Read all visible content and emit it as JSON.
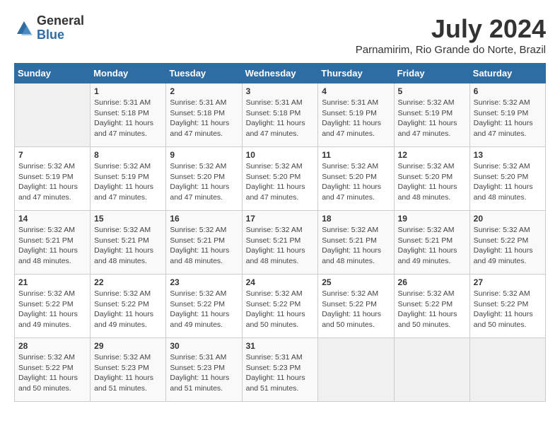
{
  "logo": {
    "general": "General",
    "blue": "Blue"
  },
  "title": {
    "month_year": "July 2024",
    "location": "Parnamirim, Rio Grande do Norte, Brazil"
  },
  "weekdays": [
    "Sunday",
    "Monday",
    "Tuesday",
    "Wednesday",
    "Thursday",
    "Friday",
    "Saturday"
  ],
  "weeks": [
    [
      {
        "day": "",
        "info": ""
      },
      {
        "day": "1",
        "info": "Sunrise: 5:31 AM\nSunset: 5:18 PM\nDaylight: 11 hours\nand 47 minutes."
      },
      {
        "day": "2",
        "info": "Sunrise: 5:31 AM\nSunset: 5:18 PM\nDaylight: 11 hours\nand 47 minutes."
      },
      {
        "day": "3",
        "info": "Sunrise: 5:31 AM\nSunset: 5:18 PM\nDaylight: 11 hours\nand 47 minutes."
      },
      {
        "day": "4",
        "info": "Sunrise: 5:31 AM\nSunset: 5:19 PM\nDaylight: 11 hours\nand 47 minutes."
      },
      {
        "day": "5",
        "info": "Sunrise: 5:32 AM\nSunset: 5:19 PM\nDaylight: 11 hours\nand 47 minutes."
      },
      {
        "day": "6",
        "info": "Sunrise: 5:32 AM\nSunset: 5:19 PM\nDaylight: 11 hours\nand 47 minutes."
      }
    ],
    [
      {
        "day": "7",
        "info": "Sunrise: 5:32 AM\nSunset: 5:19 PM\nDaylight: 11 hours\nand 47 minutes."
      },
      {
        "day": "8",
        "info": "Sunrise: 5:32 AM\nSunset: 5:19 PM\nDaylight: 11 hours\nand 47 minutes."
      },
      {
        "day": "9",
        "info": "Sunrise: 5:32 AM\nSunset: 5:20 PM\nDaylight: 11 hours\nand 47 minutes."
      },
      {
        "day": "10",
        "info": "Sunrise: 5:32 AM\nSunset: 5:20 PM\nDaylight: 11 hours\nand 47 minutes."
      },
      {
        "day": "11",
        "info": "Sunrise: 5:32 AM\nSunset: 5:20 PM\nDaylight: 11 hours\nand 47 minutes."
      },
      {
        "day": "12",
        "info": "Sunrise: 5:32 AM\nSunset: 5:20 PM\nDaylight: 11 hours\nand 48 minutes."
      },
      {
        "day": "13",
        "info": "Sunrise: 5:32 AM\nSunset: 5:20 PM\nDaylight: 11 hours\nand 48 minutes."
      }
    ],
    [
      {
        "day": "14",
        "info": "Sunrise: 5:32 AM\nSunset: 5:21 PM\nDaylight: 11 hours\nand 48 minutes."
      },
      {
        "day": "15",
        "info": "Sunrise: 5:32 AM\nSunset: 5:21 PM\nDaylight: 11 hours\nand 48 minutes."
      },
      {
        "day": "16",
        "info": "Sunrise: 5:32 AM\nSunset: 5:21 PM\nDaylight: 11 hours\nand 48 minutes."
      },
      {
        "day": "17",
        "info": "Sunrise: 5:32 AM\nSunset: 5:21 PM\nDaylight: 11 hours\nand 48 minutes."
      },
      {
        "day": "18",
        "info": "Sunrise: 5:32 AM\nSunset: 5:21 PM\nDaylight: 11 hours\nand 48 minutes."
      },
      {
        "day": "19",
        "info": "Sunrise: 5:32 AM\nSunset: 5:21 PM\nDaylight: 11 hours\nand 49 minutes."
      },
      {
        "day": "20",
        "info": "Sunrise: 5:32 AM\nSunset: 5:22 PM\nDaylight: 11 hours\nand 49 minutes."
      }
    ],
    [
      {
        "day": "21",
        "info": "Sunrise: 5:32 AM\nSunset: 5:22 PM\nDaylight: 11 hours\nand 49 minutes."
      },
      {
        "day": "22",
        "info": "Sunrise: 5:32 AM\nSunset: 5:22 PM\nDaylight: 11 hours\nand 49 minutes."
      },
      {
        "day": "23",
        "info": "Sunrise: 5:32 AM\nSunset: 5:22 PM\nDaylight: 11 hours\nand 49 minutes."
      },
      {
        "day": "24",
        "info": "Sunrise: 5:32 AM\nSunset: 5:22 PM\nDaylight: 11 hours\nand 50 minutes."
      },
      {
        "day": "25",
        "info": "Sunrise: 5:32 AM\nSunset: 5:22 PM\nDaylight: 11 hours\nand 50 minutes."
      },
      {
        "day": "26",
        "info": "Sunrise: 5:32 AM\nSunset: 5:22 PM\nDaylight: 11 hours\nand 50 minutes."
      },
      {
        "day": "27",
        "info": "Sunrise: 5:32 AM\nSunset: 5:22 PM\nDaylight: 11 hours\nand 50 minutes."
      }
    ],
    [
      {
        "day": "28",
        "info": "Sunrise: 5:32 AM\nSunset: 5:22 PM\nDaylight: 11 hours\nand 50 minutes."
      },
      {
        "day": "29",
        "info": "Sunrise: 5:32 AM\nSunset: 5:23 PM\nDaylight: 11 hours\nand 51 minutes."
      },
      {
        "day": "30",
        "info": "Sunrise: 5:31 AM\nSunset: 5:23 PM\nDaylight: 11 hours\nand 51 minutes."
      },
      {
        "day": "31",
        "info": "Sunrise: 5:31 AM\nSunset: 5:23 PM\nDaylight: 11 hours\nand 51 minutes."
      },
      {
        "day": "",
        "info": ""
      },
      {
        "day": "",
        "info": ""
      },
      {
        "day": "",
        "info": ""
      }
    ]
  ]
}
